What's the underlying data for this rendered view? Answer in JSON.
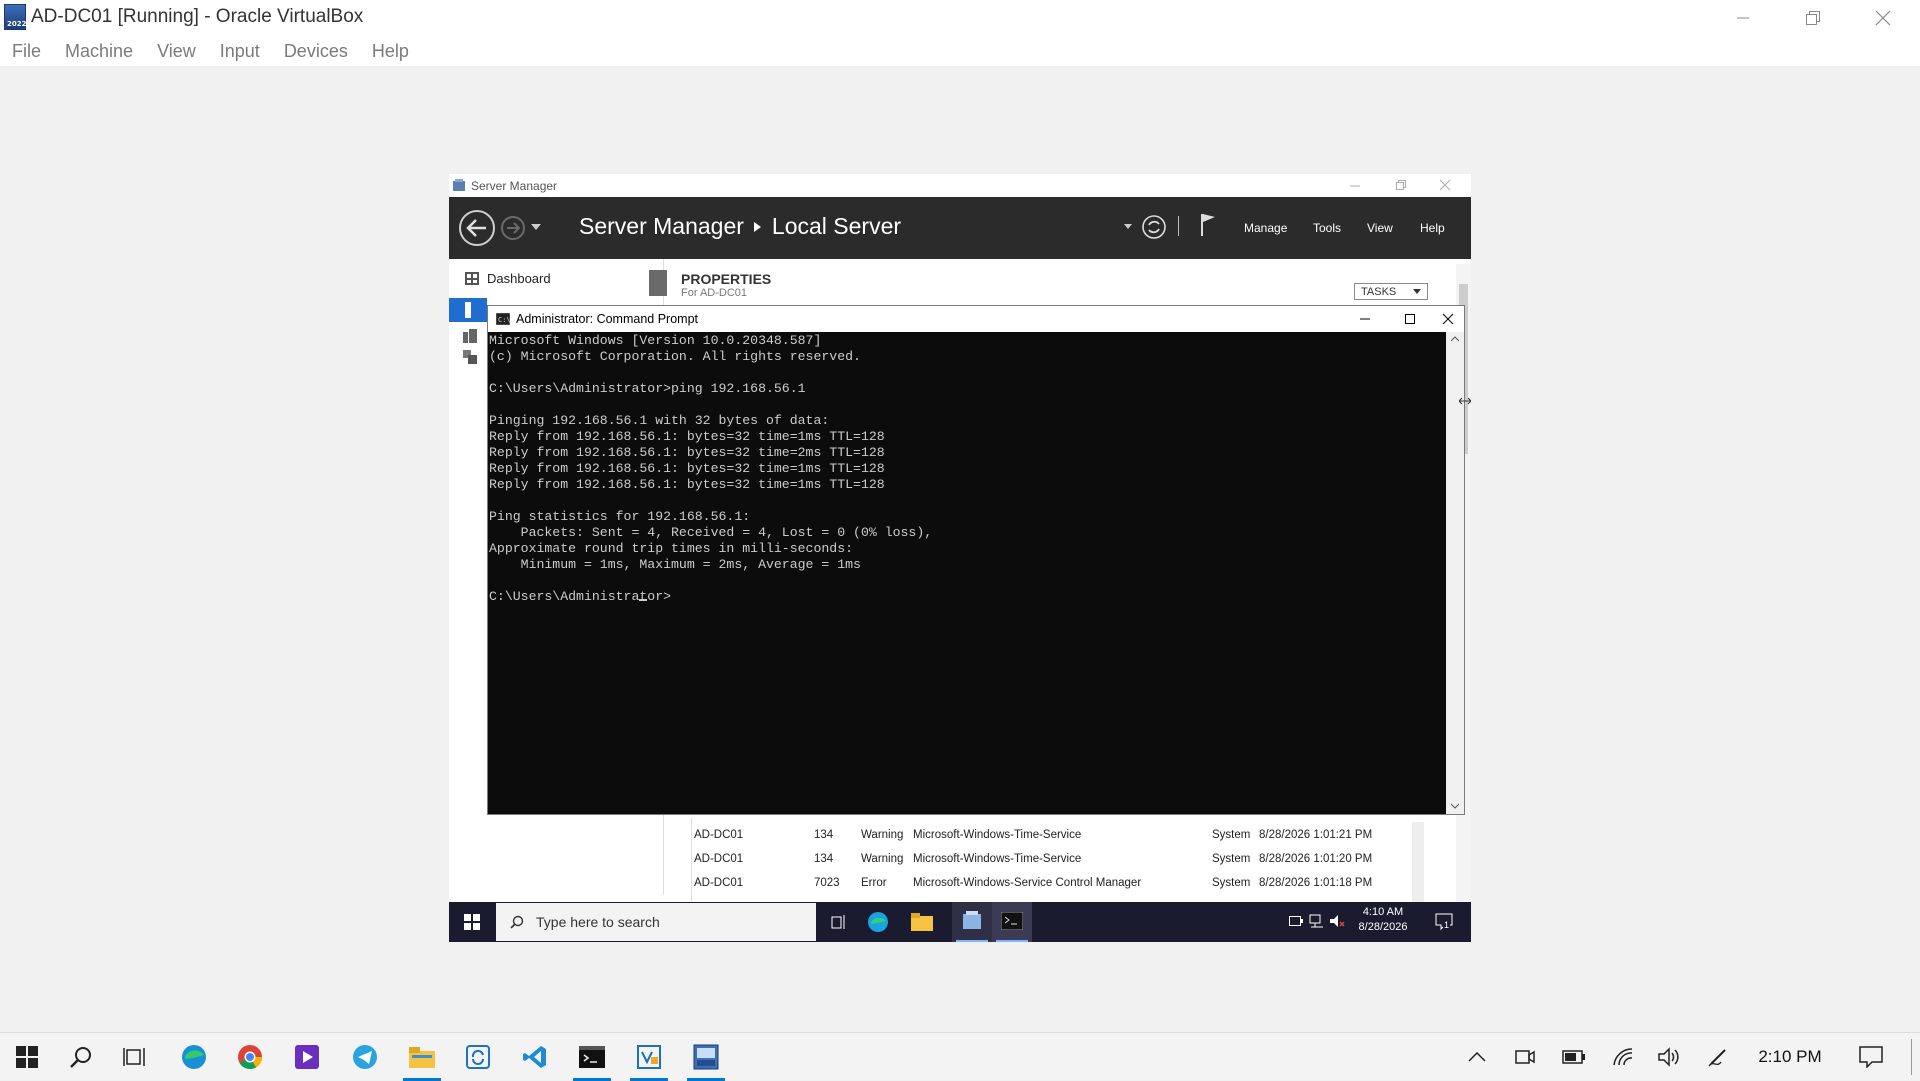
{
  "host": {
    "title": "AD-DC01 [Running] - Oracle VirtualBox",
    "icon_badge": "2022",
    "menu": [
      "File",
      "Machine",
      "View",
      "Input",
      "Devices",
      "Help"
    ]
  },
  "server_manager": {
    "window_title": "Server Manager",
    "breadcrumb_root": "Server Manager",
    "breadcrumb_page": "Local Server",
    "menu": [
      "Manage",
      "Tools",
      "View",
      "Help"
    ],
    "nav_dashboard": "Dashboard",
    "properties_title": "PROPERTIES",
    "properties_subtitle": "For AD-DC01",
    "tasks_label": "TASKS",
    "events": [
      {
        "server": "AD-DC01",
        "id": "134",
        "severity": "Warning",
        "source": "Microsoft-Windows-Time-Service",
        "log": "System",
        "date": "8/28/2026 1:01:21 PM"
      },
      {
        "server": "AD-DC01",
        "id": "134",
        "severity": "Warning",
        "source": "Microsoft-Windows-Time-Service",
        "log": "System",
        "date": "8/28/2026 1:01:20 PM"
      },
      {
        "server": "AD-DC01",
        "id": "7023",
        "severity": "Error",
        "source": "Microsoft-Windows-Service Control Manager",
        "log": "System",
        "date": "8/28/2026 1:01:18 PM"
      }
    ]
  },
  "cmd": {
    "title": "Administrator: Command Prompt",
    "output": "Microsoft Windows [Version 10.0.20348.587]\n(c) Microsoft Corporation. All rights reserved.\n\nC:\\Users\\Administrator>ping 192.168.56.1\n\nPinging 192.168.56.1 with 32 bytes of data:\nReply from 192.168.56.1: bytes=32 time=1ms TTL=128\nReply from 192.168.56.1: bytes=32 time=2ms TTL=128\nReply from 192.168.56.1: bytes=32 time=1ms TTL=128\nReply from 192.168.56.1: bytes=32 time=1ms TTL=128\n\nPing statistics for 192.168.56.1:\n    Packets: Sent = 4, Received = 4, Lost = 0 (0% loss),\nApproximate round trip times in milli-seconds:\n    Minimum = 1ms, Maximum = 2ms, Average = 1ms\n\nC:\\Users\\Administrator>"
  },
  "vm_taskbar": {
    "search_placeholder": "Type here to search",
    "time": "4:10 AM",
    "date": "8/28/2026",
    "notification_count": "1"
  },
  "host_taskbar": {
    "time": "2:10 PM",
    "colors": {
      "accent": "#0078d4",
      "cmd_bg": "#0c0c0c",
      "sm_header": "#2b2b2b"
    }
  }
}
